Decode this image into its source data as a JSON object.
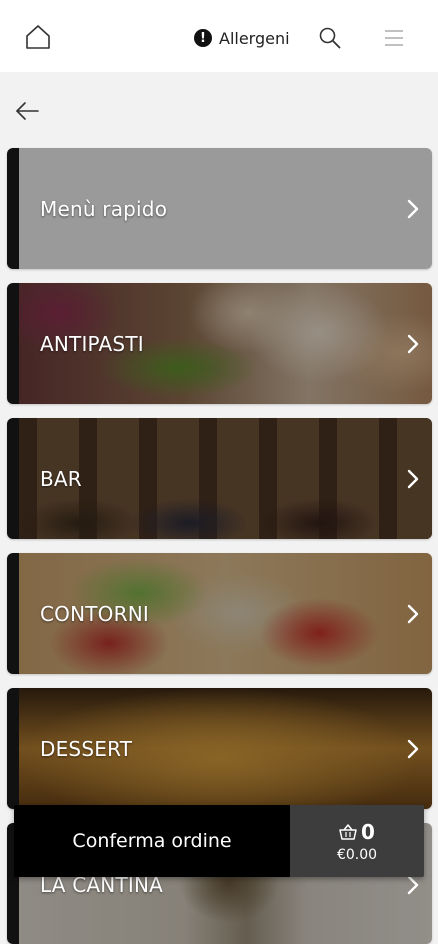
{
  "header": {
    "home_icon": "home-icon",
    "allergens_label": "Allergeni",
    "allergens_icon": "info-exclamation-icon",
    "info_glyph": "!",
    "search_icon": "search-icon",
    "menu_icon": "hamburger-menu-icon"
  },
  "nav": {
    "back_icon": "arrow-left-icon"
  },
  "categories": [
    {
      "name": "Menù rapido"
    },
    {
      "name": "ANTIPASTI"
    },
    {
      "name": "BAR"
    },
    {
      "name": "CONTORNI"
    },
    {
      "name": "DESSERT"
    },
    {
      "name": "LA CANTINA"
    }
  ],
  "order": {
    "confirm_label": "Conferma ordine",
    "cart_count": "0",
    "cart_total": "€0.00",
    "cart_icon": "basket-icon"
  },
  "colors": {
    "header_bg": "#ffffff",
    "page_bg": "#f2f2f2",
    "accent": "#111111",
    "confirm_bg": "#000000",
    "cart_bg": "#3d3d3d"
  }
}
